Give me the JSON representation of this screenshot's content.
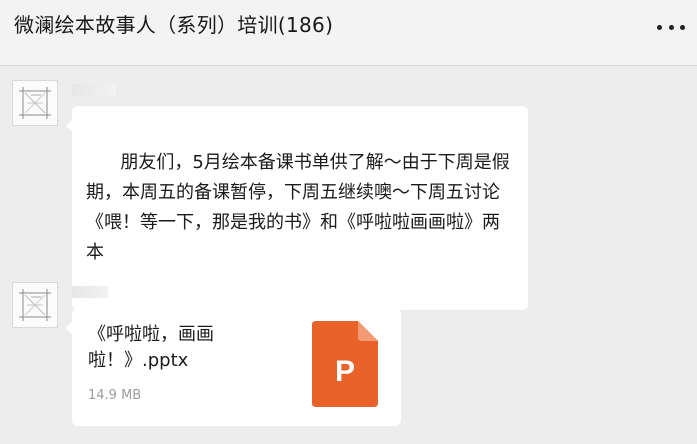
{
  "header": {
    "title": "微澜绘本故事人（系列）培训(186)",
    "more_icon": "more-horizontal-icon"
  },
  "messages": [
    {
      "type": "text",
      "avatar_icon": "avatar-sketch-icon",
      "text": "朋友们，5月绘本备课书单供了解～由于下周是假期，本周五的备课暂停，下周五继续噢～下周五讨论《喂！等一下，那是我的书》和《呼啦啦画画啦》两本"
    },
    {
      "type": "file",
      "avatar_icon": "avatar-sketch-icon",
      "file_name": "《呼啦啦，画画啦！》.pptx",
      "file_size": "14.9 MB",
      "file_icon": "powerpoint-file-icon",
      "file_icon_letter": "P",
      "file_icon_color": "#e8622a"
    }
  ],
  "colors": {
    "background": "#ededed",
    "bubble": "#ffffff",
    "ppt_accent": "#e8622a"
  }
}
